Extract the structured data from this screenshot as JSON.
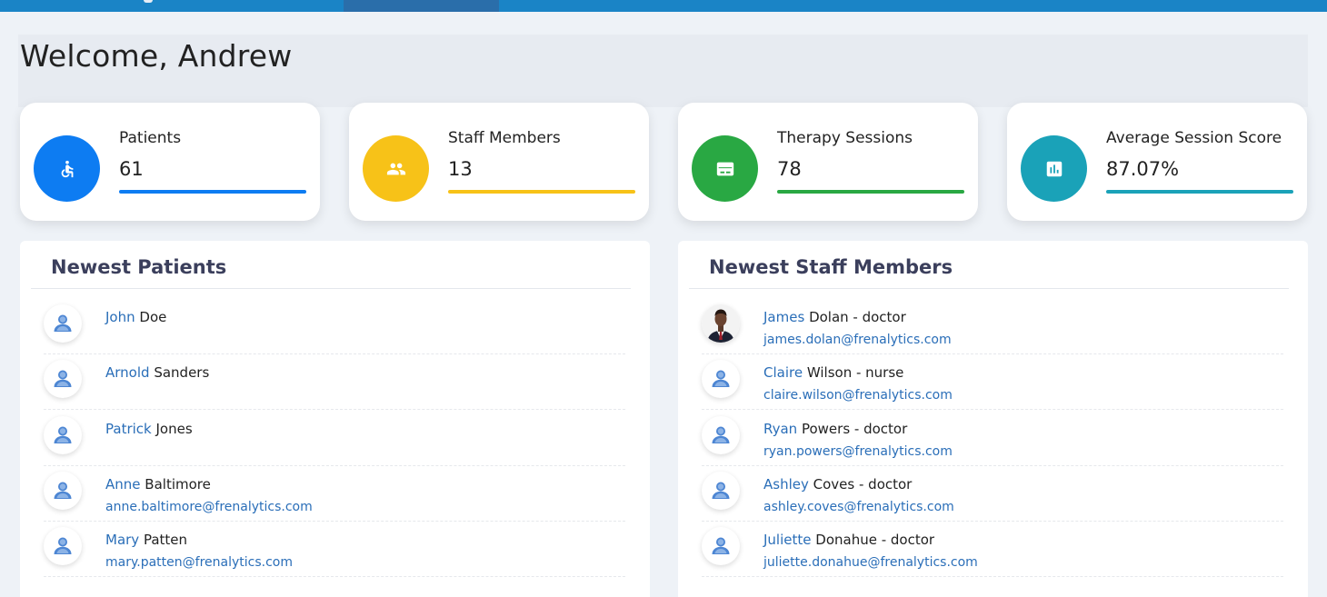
{
  "welcome": "Welcome, Andrew",
  "stats": [
    {
      "label": "Patients",
      "value": "61",
      "color": "#0d7cf2",
      "icon": "wheelchair-icon"
    },
    {
      "label": "Staff Members",
      "value": "13",
      "color": "#f7c218",
      "icon": "people-icon"
    },
    {
      "label": "Therapy Sessions",
      "value": "78",
      "color": "#29a843",
      "icon": "session-card-icon"
    },
    {
      "label": "Average Session Score",
      "value": "87.07%",
      "color": "#1aa2b8",
      "icon": "bar-chart-icon"
    }
  ],
  "newest_patients": {
    "title": "Newest Patients",
    "items": [
      {
        "first": "John",
        "last": "Doe",
        "email": ""
      },
      {
        "first": "Arnold",
        "last": "Sanders",
        "email": ""
      },
      {
        "first": "Patrick",
        "last": "Jones",
        "email": ""
      },
      {
        "first": "Anne",
        "last": "Baltimore",
        "email": "anne.baltimore@frenalytics.com"
      },
      {
        "first": "Mary",
        "last": "Patten",
        "email": "mary.patten@frenalytics.com"
      }
    ]
  },
  "newest_staff": {
    "title": "Newest Staff Members",
    "items": [
      {
        "first": "James",
        "last": "Dolan",
        "role": " - doctor",
        "email": "james.dolan@frenalytics.com",
        "photo": true
      },
      {
        "first": "Claire",
        "last": "Wilson",
        "role": " - nurse",
        "email": "claire.wilson@frenalytics.com"
      },
      {
        "first": "Ryan",
        "last": "Powers",
        "role": " - doctor",
        "email": "ryan.powers@frenalytics.com"
      },
      {
        "first": "Ashley",
        "last": "Coves",
        "role": " - doctor",
        "email": "ashley.coves@frenalytics.com"
      },
      {
        "first": "Juliette",
        "last": "Donahue",
        "role": " - doctor",
        "email": "juliette.donahue@frenalytics.com"
      }
    ]
  }
}
